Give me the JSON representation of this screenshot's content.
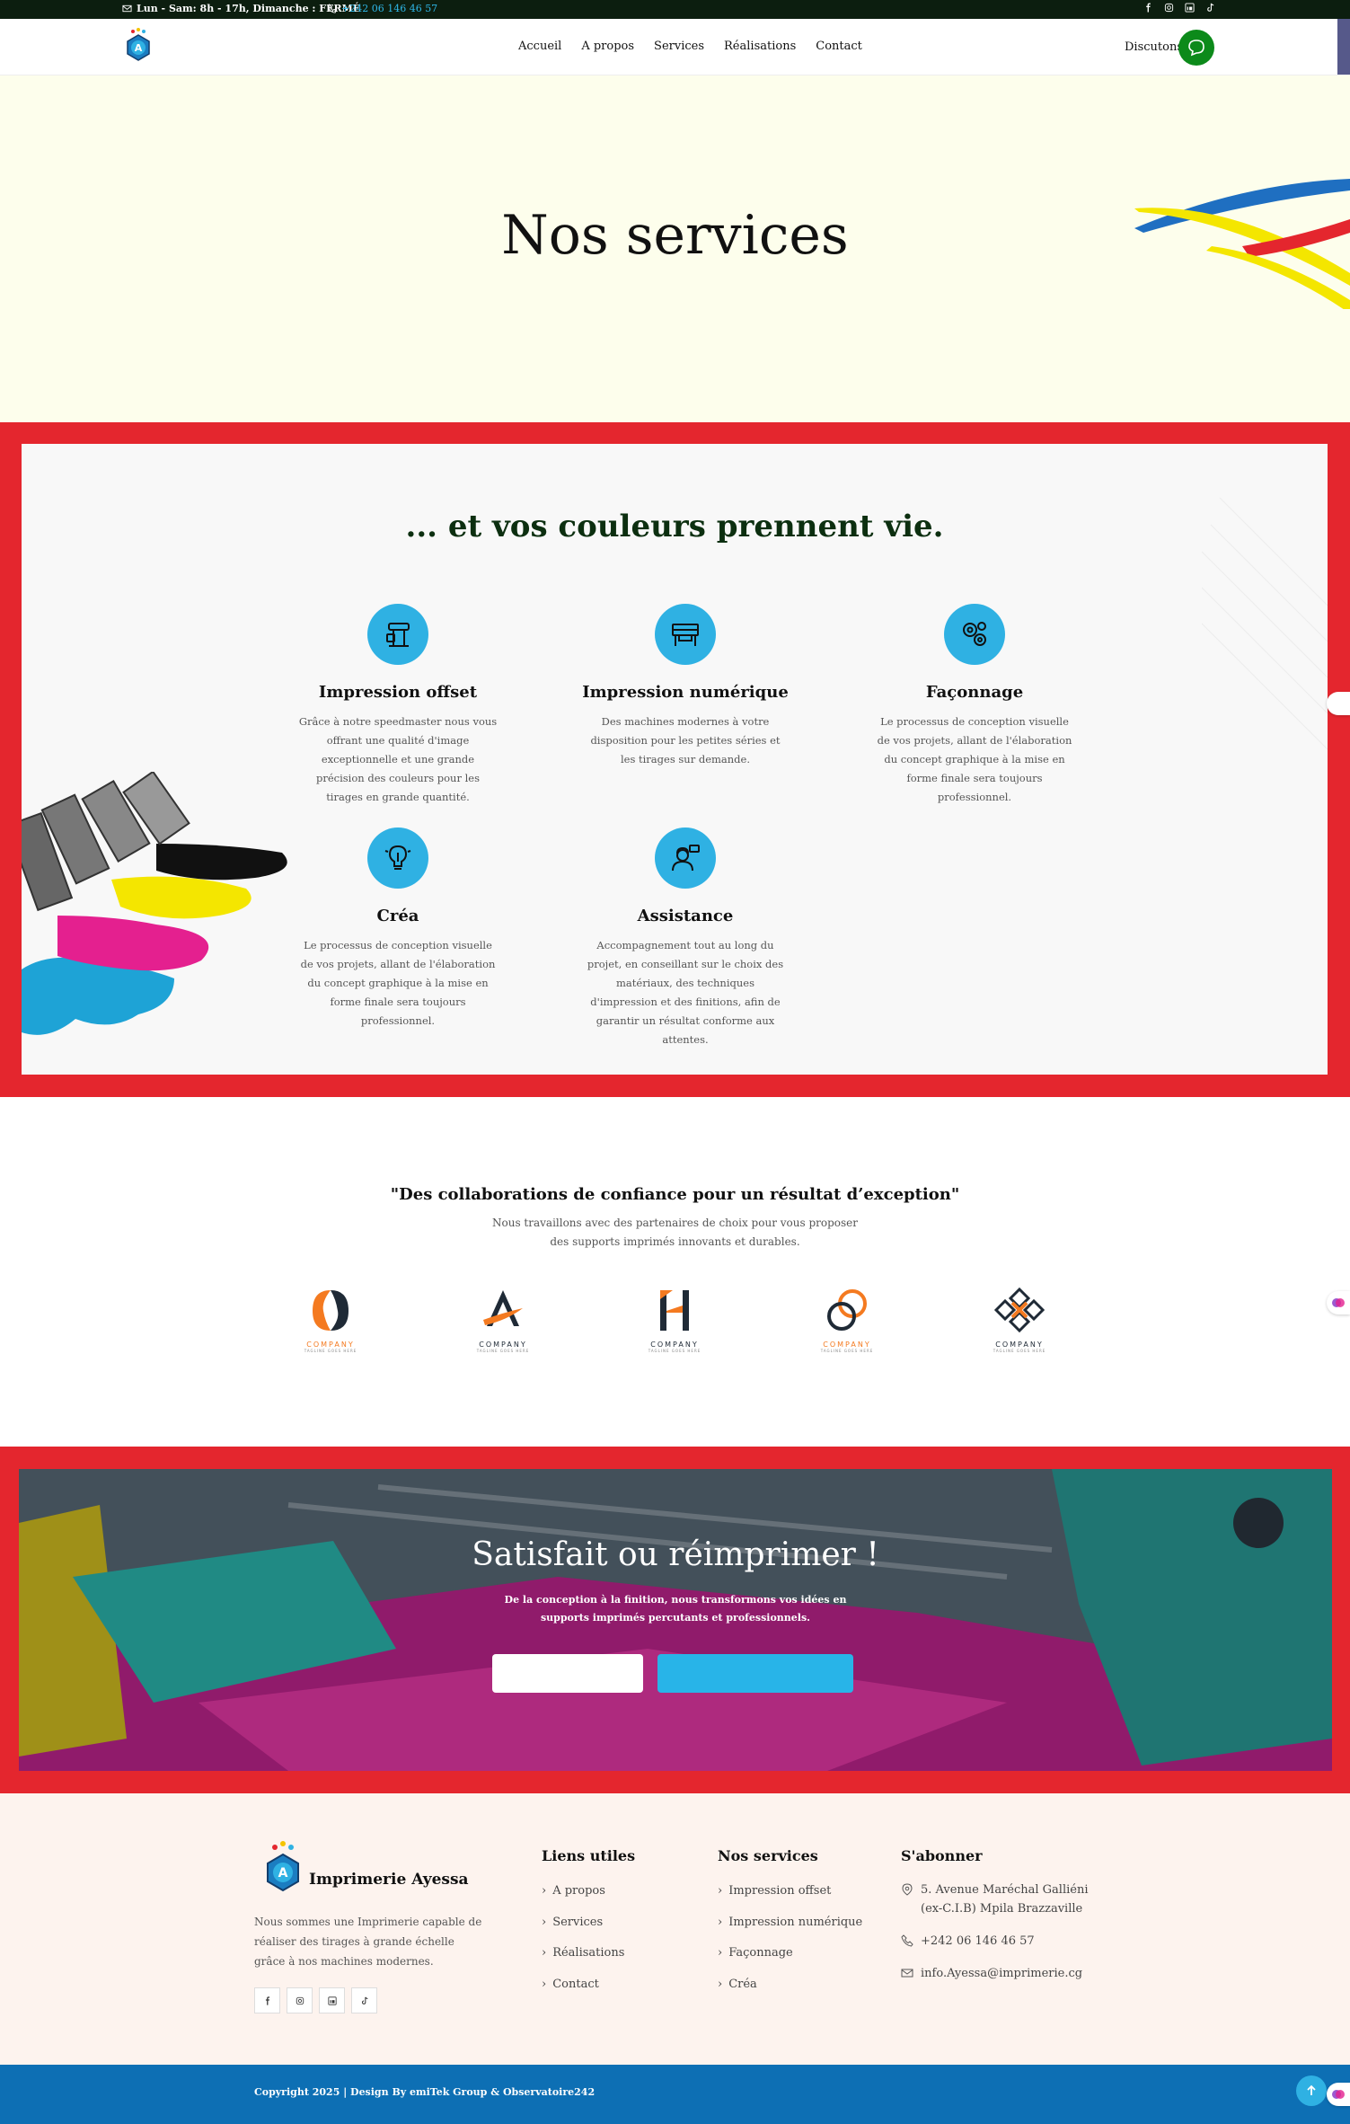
{
  "topbar": {
    "hours": "Lun - Sam: 8h - 17h, Dimanche : FERMÉ",
    "phone": "+242 06 146 46 57",
    "social": [
      "facebook-icon",
      "instagram-icon",
      "linkedin-icon",
      "tiktok-icon"
    ]
  },
  "nav": {
    "links": [
      "Accueil",
      "A propos",
      "Services",
      "Réalisations",
      "Contact"
    ],
    "discutons": "Discutons"
  },
  "hero": {
    "title": "Nos services"
  },
  "services": {
    "title": "... et vos couleurs prennent vie.",
    "items": [
      {
        "title": "Impression offset",
        "text": "Grâce à notre speedmaster nous vous offrant une qualité d'image exceptionnelle et une grande précision des couleurs pour les tirages en grande quantité.",
        "icon": "offset-printer-icon"
      },
      {
        "title": "Impression numérique",
        "text": "Des machines modernes à votre disposition pour les petites séries et les tirages sur demande.",
        "icon": "digital-printer-icon"
      },
      {
        "title": "Façonnage",
        "text": "Le processus de conception visuelle de vos projets, allant de l'élaboration du concept graphique à la mise en forme finale sera toujours professionnel.",
        "icon": "gears-icon"
      },
      {
        "title": "Créa",
        "text": "Le processus de conception visuelle de vos projets, allant de l'élaboration du concept graphique à la mise en forme finale sera toujours professionnel.",
        "icon": "idea-bulb-icon"
      },
      {
        "title": "Assistance",
        "text": "Accompagnement tout au long du projet, en conseillant sur le choix des matériaux, des techniques d'impression et des finitions, afin de garantir un résultat conforme aux attentes.",
        "icon": "support-agent-icon"
      }
    ]
  },
  "partners": {
    "title": "\"Des collaborations de confiance pour un résultat d’exception\"",
    "subtitle": "Nous travaillons avec des partenaires de choix pour vous proposer des supports imprimés innovants et durables.",
    "logos": [
      {
        "name": "COMPANY",
        "tagline": "TAGLINE GOES HERE",
        "color": "#f47a20"
      },
      {
        "name": "COMPANY",
        "tagline": "TAGLINE GOES HERE",
        "color": "#1f2a36"
      },
      {
        "name": "COMPANY",
        "tagline": "TAGLINE GOES HERE",
        "color": "#1f2a36"
      },
      {
        "name": "COMPANY",
        "tagline": "TAGLINE GOES HERE",
        "color": "#f47a20"
      },
      {
        "name": "COMPANY",
        "tagline": "TAGLINE GOES HERE",
        "color": "#1f2a36"
      }
    ]
  },
  "cta": {
    "title": "Satisfait ou réimprimer !",
    "text": "De la conception à la finition, nous transformons vos idées en supports imprimés percutants et professionnels."
  },
  "footer": {
    "brand": "Imprimerie Ayessa",
    "description": "Nous sommes une Imprimerie capable de réaliser des tirages à grande échelle grâce à nos machines modernes.",
    "useful_title": "Liens utiles",
    "useful_links": [
      "A propos",
      "Services",
      "Réalisations",
      "Contact"
    ],
    "services_title": "Nos services",
    "services_links": [
      "Impression offset",
      "Impression numérique",
      "Façonnage",
      "Créa"
    ],
    "subscribe_title": "S'abonner",
    "address": "5. Avenue Maréchal Galliéni (ex-C.I.B) Mpila Brazzaville",
    "phone": "+242 06 146 46 57",
    "email": "info.Ayessa@imprimerie.cg"
  },
  "copyright": "Copyright 2025 | Design By emiTek Group & Observatoire242",
  "colors": {
    "red": "#e4262e",
    "blue": "#2fb1e3",
    "dark_green": "#0c1e0f",
    "footer_blue": "#0d6fb4"
  }
}
